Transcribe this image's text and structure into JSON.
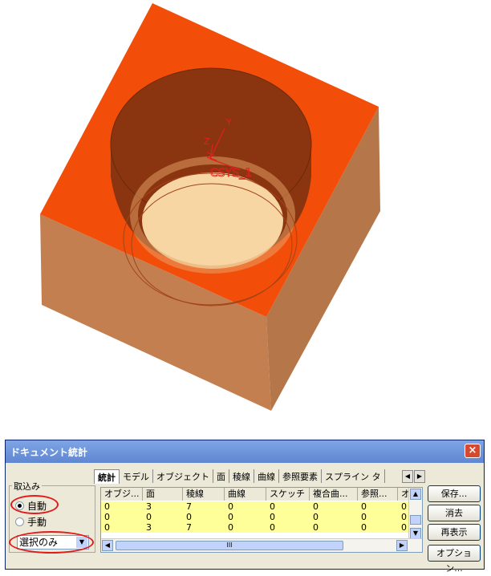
{
  "viewport": {
    "axis_label_y": "Y",
    "axis_label_z": "Z",
    "csys_label": "CSYS_1",
    "colors": {
      "top": "#f24e0a",
      "side_left": "#c47f51",
      "side_right": "#b5764a",
      "hole_dark": "#8a3510",
      "hole_floor": "#f7d6a3",
      "annotation": "#e02020"
    }
  },
  "dialog": {
    "title": "ドキュメント統計",
    "close_icon": "×",
    "capture_group": {
      "title": "取込み",
      "options": [
        "自動",
        "手動"
      ],
      "selected": "自動",
      "combo_value": "選択のみ"
    },
    "tabs": [
      "統計",
      "モデル",
      "オブジェクト",
      "面",
      "稜線",
      "曲線",
      "参照要素",
      "スプライン タ"
    ],
    "selected_tab": "統計",
    "table": {
      "columns": [
        "オブジ...",
        "面",
        "稜線",
        "曲線",
        "スケッチ",
        "複合曲...",
        "参照...",
        "オ"
      ],
      "rows": [
        [
          "0",
          "3",
          "7",
          "0",
          "0",
          "0",
          "0",
          "0"
        ],
        [
          "0",
          "0",
          "0",
          "0",
          "0",
          "0",
          "0",
          "0"
        ],
        [
          "0",
          "3",
          "7",
          "0",
          "0",
          "0",
          "0",
          "0"
        ]
      ],
      "hscroll_grip": "III"
    },
    "buttons": {
      "save": "保存...",
      "clear": "消去",
      "refresh": "再表示",
      "options": "オプション..."
    }
  }
}
